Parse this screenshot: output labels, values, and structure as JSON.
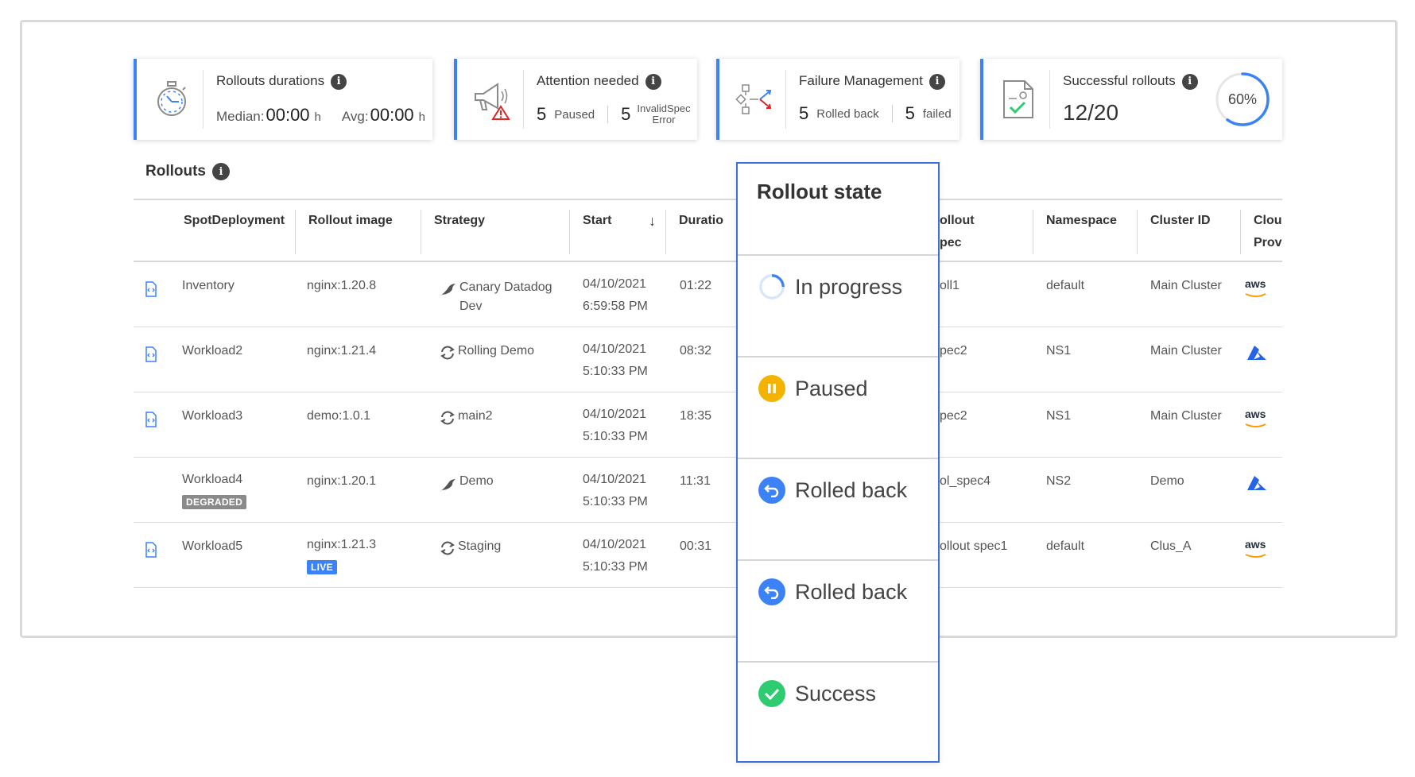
{
  "cards": {
    "durations": {
      "title": "Rollouts durations",
      "median_label": "Median:",
      "median_value": "00:00",
      "median_unit": "h",
      "avg_label": "Avg:",
      "avg_value": "00:00",
      "avg_unit": "h"
    },
    "attention": {
      "title": "Attention needed",
      "paused_count": "5",
      "paused_label": "Paused",
      "invalid_count": "5",
      "invalid_label_1": "InvalidSpec",
      "invalid_label_2": "Error"
    },
    "failure": {
      "title": "Failure Management",
      "rolled_back_count": "5",
      "rolled_back_label": "Rolled back",
      "failed_count": "5",
      "failed_label": "failed"
    },
    "successful": {
      "title": "Successful rollouts",
      "value": "12/20",
      "percent_label": "60%",
      "percent": 0.6
    }
  },
  "section": {
    "title": "Rollouts"
  },
  "table": {
    "headers": {
      "spotdeployment": "SpotDeployment",
      "image": "Rollout image",
      "strategy": "Strategy",
      "start": "Start",
      "duration": "Duratio",
      "rollout_spec_1": "ollout",
      "rollout_spec_2": "pec",
      "namespace": "Namespace",
      "cluster": "Cluster ID",
      "cloud_1": "Cloud",
      "cloud_2": "Provi"
    },
    "rows": [
      {
        "name": "Inventory",
        "image": "nginx:1.20.8",
        "strategy_1": "Canary Datadog",
        "strategy_2": "Dev",
        "date": "04/10/2021",
        "time": "6:59:58 PM",
        "duration": "01:22",
        "spec": "oll1",
        "namespace": "default",
        "cluster": "Main Cluster",
        "cloud": "aws"
      },
      {
        "name": "Workload2",
        "image": "nginx:1.21.4",
        "strategy_1": "Rolling Demo",
        "strategy_2": "",
        "date": "04/10/2021",
        "time": "5:10:33 PM",
        "duration": "08:32",
        "spec": "pec2",
        "namespace": "NS1",
        "cluster": "Main Cluster",
        "cloud": "azure"
      },
      {
        "name": "Workload3",
        "image": "demo:1.0.1",
        "strategy_1": "main2",
        "strategy_2": "",
        "date": "04/10/2021",
        "time": "5:10:33 PM",
        "duration": "18:35",
        "spec": "pec2",
        "namespace": "NS1",
        "cluster": "Main Cluster",
        "cloud": "aws"
      },
      {
        "name": "Workload4",
        "badge": "DEGRADED",
        "image": "nginx:1.20.1",
        "strategy_1": "Demo",
        "strategy_2": "",
        "date": "04/10/2021",
        "time": "5:10:33 PM",
        "duration": "11:31",
        "spec": "ol_spec4",
        "namespace": "NS2",
        "cluster": "Demo",
        "cloud": "azure"
      },
      {
        "name": "Workload5",
        "image": "nginx:1.21.3",
        "image_badge": "LIVE",
        "strategy_1": "Staging",
        "strategy_2": "",
        "date": "04/10/2021",
        "time": "5:10:33 PM",
        "duration": "00:31",
        "spec": "ollout spec1",
        "namespace": "default",
        "cluster": "Clus_A",
        "cloud": "aws"
      }
    ]
  },
  "popup": {
    "title": "Rollout state",
    "options": [
      {
        "label": "In progress",
        "state": "in-progress"
      },
      {
        "label": "Paused",
        "state": "paused",
        "color": "#f5b301"
      },
      {
        "label": "Rolled back",
        "state": "rolled-back",
        "color": "#3b82f6"
      },
      {
        "label": "Rolled back",
        "state": "rolled-back",
        "color": "#3b82f6"
      },
      {
        "label": "Success",
        "state": "success",
        "color": "#2ecc71"
      }
    ]
  },
  "colors": {
    "accent": "#3b82f6",
    "aws_text": "#232f3e",
    "aws_smile": "#ff9900",
    "azure": "#2563eb"
  }
}
